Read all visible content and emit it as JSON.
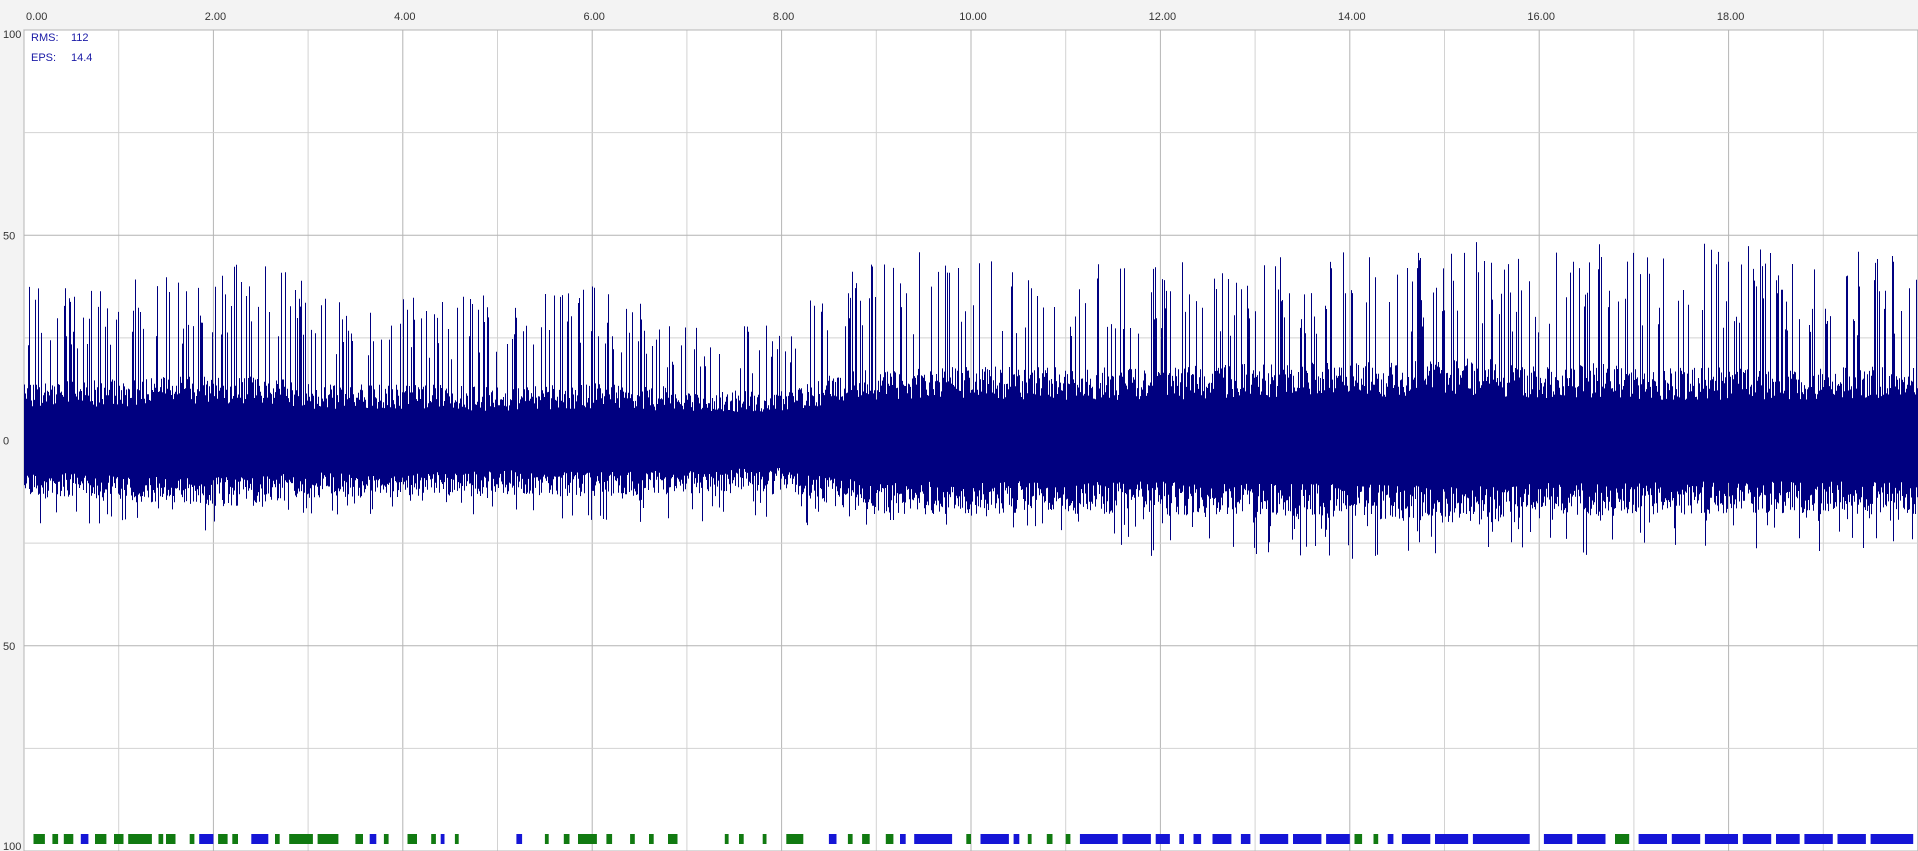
{
  "stats": {
    "rms_label": "RMS:",
    "rms_value": "112",
    "eps_label": "EPS:",
    "eps_value": "14.4"
  },
  "colors": {
    "signal": "#000080",
    "marker_green": "#117a11",
    "marker_blue": "#1515d6",
    "grid": "#b4b4b4",
    "grid_minor": "#d2d2d2",
    "background": "#ffffff"
  },
  "chart_data": {
    "type": "line",
    "xlim": [
      0,
      20
    ],
    "ylim": [
      -100,
      100
    ],
    "x_ticks": [
      0,
      2,
      4,
      6,
      8,
      10,
      12,
      14,
      16,
      18
    ],
    "x_tick_labels": [
      "0.00",
      "2.00",
      "4.00",
      "6.00",
      "8.00",
      "10.00",
      "12.00",
      "14.00",
      "16.00",
      "18.00"
    ],
    "y_ticks": [
      100,
      50,
      0,
      -50,
      -100
    ],
    "y_tick_labels": [
      "100",
      "50",
      "0",
      "50",
      "100"
    ],
    "grid": true,
    "series": [
      {
        "envelope": {
          "x": [
            0.0,
            1.0,
            2.0,
            2.4,
            3.0,
            4.0,
            5.0,
            6.0,
            7.0,
            8.0,
            8.5,
            9.0,
            10.0,
            11.0,
            11.6,
            12.0,
            13.0,
            14.0,
            15.0,
            15.5,
            16.0,
            16.5,
            17.0,
            18.0,
            19.0,
            20.0
          ],
          "y_max": [
            38,
            40,
            40,
            46,
            38,
            36,
            36,
            38,
            30,
            28,
            44,
            47,
            46,
            46,
            45,
            44,
            47,
            46,
            48,
            50,
            45,
            52,
            47,
            50,
            47,
            46
          ],
          "y_min": [
            -20,
            -22,
            -22,
            -20,
            -18,
            -18,
            -18,
            -20,
            -20,
            -20,
            -22,
            -22,
            -22,
            -22,
            -30,
            -28,
            -30,
            -30,
            -28,
            -30,
            -26,
            -28,
            -26,
            -26,
            -28,
            -28
          ],
          "core": [
            14,
            15,
            16,
            16,
            14,
            14,
            13,
            14,
            13,
            12,
            16,
            18,
            18,
            18,
            18,
            18,
            19,
            19,
            20,
            20,
            18,
            19,
            18,
            18,
            18,
            18
          ]
        }
      }
    ],
    "event_markers": [
      {
        "x": 0.1,
        "w": 0.12,
        "cls": "green"
      },
      {
        "x": 0.3,
        "w": 0.06,
        "cls": "green"
      },
      {
        "x": 0.42,
        "w": 0.1,
        "cls": "green"
      },
      {
        "x": 0.6,
        "w": 0.08,
        "cls": "blue"
      },
      {
        "x": 0.75,
        "w": 0.12,
        "cls": "green"
      },
      {
        "x": 0.95,
        "w": 0.1,
        "cls": "green"
      },
      {
        "x": 1.1,
        "w": 0.25,
        "cls": "green"
      },
      {
        "x": 1.42,
        "w": 0.05,
        "cls": "green"
      },
      {
        "x": 1.5,
        "w": 0.1,
        "cls": "green"
      },
      {
        "x": 1.75,
        "w": 0.05,
        "cls": "green"
      },
      {
        "x": 1.85,
        "w": 0.15,
        "cls": "blue"
      },
      {
        "x": 2.05,
        "w": 0.1,
        "cls": "green"
      },
      {
        "x": 2.2,
        "w": 0.06,
        "cls": "green"
      },
      {
        "x": 2.4,
        "w": 0.18,
        "cls": "blue"
      },
      {
        "x": 2.65,
        "w": 0.05,
        "cls": "green"
      },
      {
        "x": 2.8,
        "w": 0.25,
        "cls": "green"
      },
      {
        "x": 3.1,
        "w": 0.22,
        "cls": "green"
      },
      {
        "x": 3.5,
        "w": 0.08,
        "cls": "green"
      },
      {
        "x": 3.65,
        "w": 0.07,
        "cls": "blue"
      },
      {
        "x": 3.8,
        "w": 0.05,
        "cls": "green"
      },
      {
        "x": 4.05,
        "w": 0.1,
        "cls": "green"
      },
      {
        "x": 4.3,
        "w": 0.05,
        "cls": "green"
      },
      {
        "x": 4.4,
        "w": 0.04,
        "cls": "blue"
      },
      {
        "x": 4.55,
        "w": 0.04,
        "cls": "green"
      },
      {
        "x": 5.2,
        "w": 0.06,
        "cls": "blue"
      },
      {
        "x": 5.5,
        "w": 0.04,
        "cls": "green"
      },
      {
        "x": 5.7,
        "w": 0.06,
        "cls": "green"
      },
      {
        "x": 5.85,
        "w": 0.2,
        "cls": "green"
      },
      {
        "x": 6.15,
        "w": 0.06,
        "cls": "green"
      },
      {
        "x": 6.4,
        "w": 0.05,
        "cls": "green"
      },
      {
        "x": 6.6,
        "w": 0.05,
        "cls": "green"
      },
      {
        "x": 6.8,
        "w": 0.1,
        "cls": "green"
      },
      {
        "x": 7.4,
        "w": 0.04,
        "cls": "green"
      },
      {
        "x": 7.55,
        "w": 0.05,
        "cls": "green"
      },
      {
        "x": 7.8,
        "w": 0.04,
        "cls": "green"
      },
      {
        "x": 8.05,
        "w": 0.18,
        "cls": "green"
      },
      {
        "x": 8.5,
        "w": 0.08,
        "cls": "blue"
      },
      {
        "x": 8.7,
        "w": 0.05,
        "cls": "green"
      },
      {
        "x": 8.85,
        "w": 0.08,
        "cls": "green"
      },
      {
        "x": 9.1,
        "w": 0.08,
        "cls": "green"
      },
      {
        "x": 9.25,
        "w": 0.06,
        "cls": "blue"
      },
      {
        "x": 9.4,
        "w": 0.4,
        "cls": "blue"
      },
      {
        "x": 9.95,
        "w": 0.05,
        "cls": "green"
      },
      {
        "x": 10.1,
        "w": 0.3,
        "cls": "blue"
      },
      {
        "x": 10.45,
        "w": 0.06,
        "cls": "blue"
      },
      {
        "x": 10.6,
        "w": 0.04,
        "cls": "green"
      },
      {
        "x": 10.8,
        "w": 0.06,
        "cls": "green"
      },
      {
        "x": 11.0,
        "w": 0.05,
        "cls": "green"
      },
      {
        "x": 11.15,
        "w": 0.4,
        "cls": "blue"
      },
      {
        "x": 11.6,
        "w": 0.3,
        "cls": "blue"
      },
      {
        "x": 11.95,
        "w": 0.15,
        "cls": "blue"
      },
      {
        "x": 12.2,
        "w": 0.05,
        "cls": "blue"
      },
      {
        "x": 12.35,
        "w": 0.08,
        "cls": "blue"
      },
      {
        "x": 12.55,
        "w": 0.2,
        "cls": "blue"
      },
      {
        "x": 12.85,
        "w": 0.1,
        "cls": "blue"
      },
      {
        "x": 13.05,
        "w": 0.3,
        "cls": "blue"
      },
      {
        "x": 13.4,
        "w": 0.3,
        "cls": "blue"
      },
      {
        "x": 13.75,
        "w": 0.25,
        "cls": "blue"
      },
      {
        "x": 14.05,
        "w": 0.08,
        "cls": "green"
      },
      {
        "x": 14.25,
        "w": 0.05,
        "cls": "green"
      },
      {
        "x": 14.4,
        "w": 0.06,
        "cls": "blue"
      },
      {
        "x": 14.55,
        "w": 0.3,
        "cls": "blue"
      },
      {
        "x": 14.9,
        "w": 0.35,
        "cls": "blue"
      },
      {
        "x": 15.3,
        "w": 0.6,
        "cls": "blue"
      },
      {
        "x": 16.05,
        "w": 0.3,
        "cls": "blue"
      },
      {
        "x": 16.4,
        "w": 0.3,
        "cls": "blue"
      },
      {
        "x": 16.8,
        "w": 0.15,
        "cls": "green"
      },
      {
        "x": 17.05,
        "w": 0.3,
        "cls": "blue"
      },
      {
        "x": 17.4,
        "w": 0.3,
        "cls": "blue"
      },
      {
        "x": 17.75,
        "w": 0.35,
        "cls": "blue"
      },
      {
        "x": 18.15,
        "w": 0.3,
        "cls": "blue"
      },
      {
        "x": 18.5,
        "w": 0.25,
        "cls": "blue"
      },
      {
        "x": 18.8,
        "w": 0.3,
        "cls": "blue"
      },
      {
        "x": 19.15,
        "w": 0.3,
        "cls": "blue"
      },
      {
        "x": 19.5,
        "w": 0.45,
        "cls": "blue"
      }
    ]
  }
}
